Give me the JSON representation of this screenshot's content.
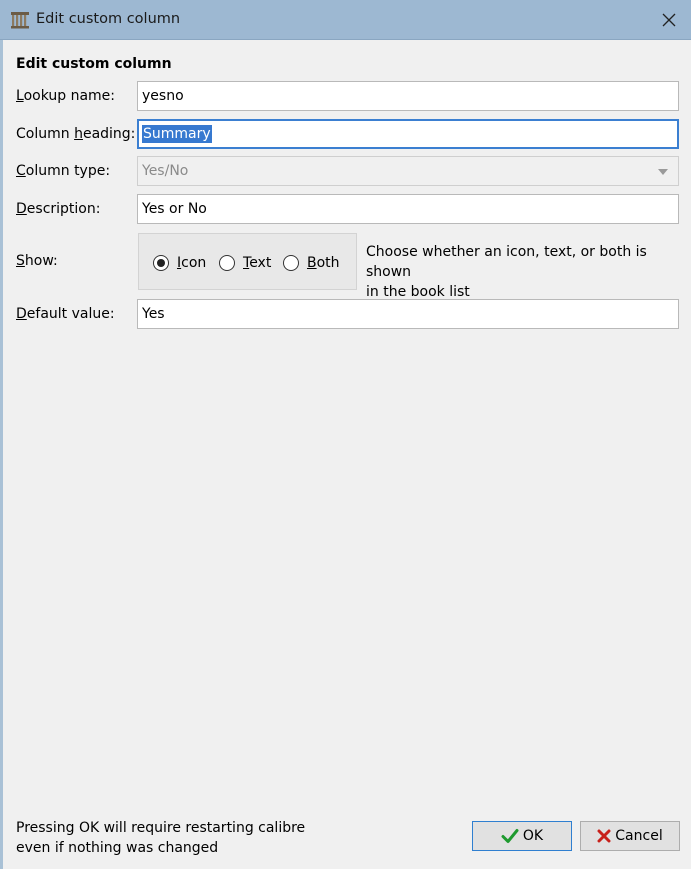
{
  "window": {
    "title": "Edit custom column"
  },
  "form": {
    "heading": "Edit custom column",
    "lookup_name": {
      "label_pre": "",
      "label_ul": "L",
      "label_post": "ookup name:",
      "value": "yesno"
    },
    "column_heading": {
      "label_pre": "Column ",
      "label_ul": "h",
      "label_post": "eading:",
      "value": "Summary"
    },
    "column_type": {
      "label_pre": "",
      "label_ul": "C",
      "label_post": "olumn type:",
      "value": "Yes/No"
    },
    "description": {
      "label_pre": "",
      "label_ul": "D",
      "label_post": "escription:",
      "value": "Yes or No"
    },
    "show": {
      "label_pre": "",
      "label_ul": "S",
      "label_post": "how:",
      "options": [
        {
          "ul": "I",
          "rest": "con",
          "checked": true
        },
        {
          "ul": "T",
          "rest": "ext",
          "checked": false
        },
        {
          "ul": "B",
          "rest": "oth",
          "checked": false
        }
      ],
      "help_line1": "Choose whether an icon, text, or both is shown",
      "help_line2": "in the book list"
    },
    "default_value": {
      "label_pre": "",
      "label_ul": "D",
      "label_post": "efault value:",
      "value": "Yes"
    }
  },
  "footer": {
    "note_line1": "Pressing OK will require restarting calibre",
    "note_line2": "even if nothing was changed",
    "ok_label": "OK",
    "cancel_label": "Cancel"
  },
  "colors": {
    "titlebar": "#9db8d2",
    "ok_check": "#1f9a2f",
    "cancel_x": "#c8211b",
    "selection": "#3779d0"
  }
}
